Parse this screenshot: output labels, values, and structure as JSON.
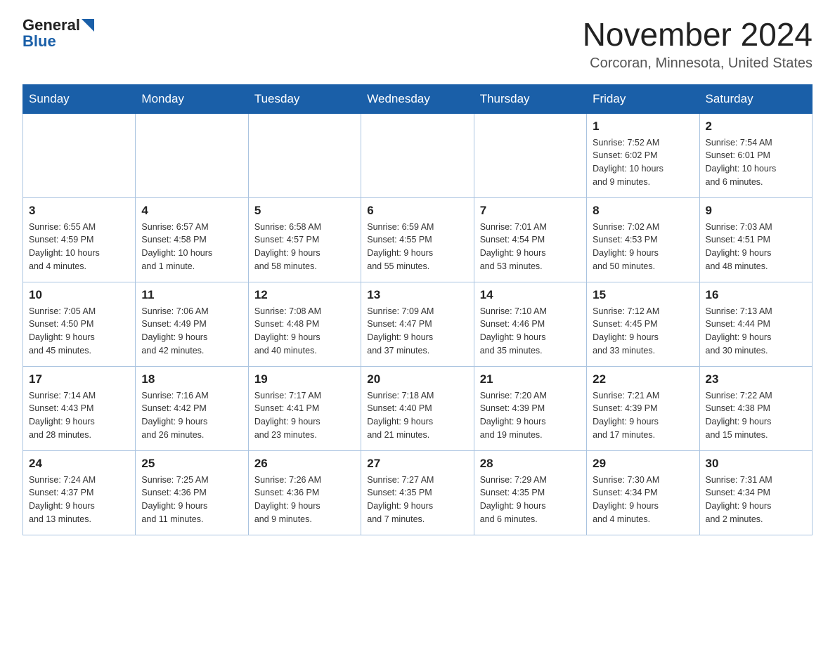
{
  "logo": {
    "part1": "General",
    "part2": "Blue"
  },
  "title": "November 2024",
  "location": "Corcoran, Minnesota, United States",
  "weekdays": [
    "Sunday",
    "Monday",
    "Tuesday",
    "Wednesday",
    "Thursday",
    "Friday",
    "Saturday"
  ],
  "weeks": [
    [
      {
        "day": "",
        "info": ""
      },
      {
        "day": "",
        "info": ""
      },
      {
        "day": "",
        "info": ""
      },
      {
        "day": "",
        "info": ""
      },
      {
        "day": "",
        "info": ""
      },
      {
        "day": "1",
        "info": "Sunrise: 7:52 AM\nSunset: 6:02 PM\nDaylight: 10 hours\nand 9 minutes."
      },
      {
        "day": "2",
        "info": "Sunrise: 7:54 AM\nSunset: 6:01 PM\nDaylight: 10 hours\nand 6 minutes."
      }
    ],
    [
      {
        "day": "3",
        "info": "Sunrise: 6:55 AM\nSunset: 4:59 PM\nDaylight: 10 hours\nand 4 minutes."
      },
      {
        "day": "4",
        "info": "Sunrise: 6:57 AM\nSunset: 4:58 PM\nDaylight: 10 hours\nand 1 minute."
      },
      {
        "day": "5",
        "info": "Sunrise: 6:58 AM\nSunset: 4:57 PM\nDaylight: 9 hours\nand 58 minutes."
      },
      {
        "day": "6",
        "info": "Sunrise: 6:59 AM\nSunset: 4:55 PM\nDaylight: 9 hours\nand 55 minutes."
      },
      {
        "day": "7",
        "info": "Sunrise: 7:01 AM\nSunset: 4:54 PM\nDaylight: 9 hours\nand 53 minutes."
      },
      {
        "day": "8",
        "info": "Sunrise: 7:02 AM\nSunset: 4:53 PM\nDaylight: 9 hours\nand 50 minutes."
      },
      {
        "day": "9",
        "info": "Sunrise: 7:03 AM\nSunset: 4:51 PM\nDaylight: 9 hours\nand 48 minutes."
      }
    ],
    [
      {
        "day": "10",
        "info": "Sunrise: 7:05 AM\nSunset: 4:50 PM\nDaylight: 9 hours\nand 45 minutes."
      },
      {
        "day": "11",
        "info": "Sunrise: 7:06 AM\nSunset: 4:49 PM\nDaylight: 9 hours\nand 42 minutes."
      },
      {
        "day": "12",
        "info": "Sunrise: 7:08 AM\nSunset: 4:48 PM\nDaylight: 9 hours\nand 40 minutes."
      },
      {
        "day": "13",
        "info": "Sunrise: 7:09 AM\nSunset: 4:47 PM\nDaylight: 9 hours\nand 37 minutes."
      },
      {
        "day": "14",
        "info": "Sunrise: 7:10 AM\nSunset: 4:46 PM\nDaylight: 9 hours\nand 35 minutes."
      },
      {
        "day": "15",
        "info": "Sunrise: 7:12 AM\nSunset: 4:45 PM\nDaylight: 9 hours\nand 33 minutes."
      },
      {
        "day": "16",
        "info": "Sunrise: 7:13 AM\nSunset: 4:44 PM\nDaylight: 9 hours\nand 30 minutes."
      }
    ],
    [
      {
        "day": "17",
        "info": "Sunrise: 7:14 AM\nSunset: 4:43 PM\nDaylight: 9 hours\nand 28 minutes."
      },
      {
        "day": "18",
        "info": "Sunrise: 7:16 AM\nSunset: 4:42 PM\nDaylight: 9 hours\nand 26 minutes."
      },
      {
        "day": "19",
        "info": "Sunrise: 7:17 AM\nSunset: 4:41 PM\nDaylight: 9 hours\nand 23 minutes."
      },
      {
        "day": "20",
        "info": "Sunrise: 7:18 AM\nSunset: 4:40 PM\nDaylight: 9 hours\nand 21 minutes."
      },
      {
        "day": "21",
        "info": "Sunrise: 7:20 AM\nSunset: 4:39 PM\nDaylight: 9 hours\nand 19 minutes."
      },
      {
        "day": "22",
        "info": "Sunrise: 7:21 AM\nSunset: 4:39 PM\nDaylight: 9 hours\nand 17 minutes."
      },
      {
        "day": "23",
        "info": "Sunrise: 7:22 AM\nSunset: 4:38 PM\nDaylight: 9 hours\nand 15 minutes."
      }
    ],
    [
      {
        "day": "24",
        "info": "Sunrise: 7:24 AM\nSunset: 4:37 PM\nDaylight: 9 hours\nand 13 minutes."
      },
      {
        "day": "25",
        "info": "Sunrise: 7:25 AM\nSunset: 4:36 PM\nDaylight: 9 hours\nand 11 minutes."
      },
      {
        "day": "26",
        "info": "Sunrise: 7:26 AM\nSunset: 4:36 PM\nDaylight: 9 hours\nand 9 minutes."
      },
      {
        "day": "27",
        "info": "Sunrise: 7:27 AM\nSunset: 4:35 PM\nDaylight: 9 hours\nand 7 minutes."
      },
      {
        "day": "28",
        "info": "Sunrise: 7:29 AM\nSunset: 4:35 PM\nDaylight: 9 hours\nand 6 minutes."
      },
      {
        "day": "29",
        "info": "Sunrise: 7:30 AM\nSunset: 4:34 PM\nDaylight: 9 hours\nand 4 minutes."
      },
      {
        "day": "30",
        "info": "Sunrise: 7:31 AM\nSunset: 4:34 PM\nDaylight: 9 hours\nand 2 minutes."
      }
    ]
  ]
}
